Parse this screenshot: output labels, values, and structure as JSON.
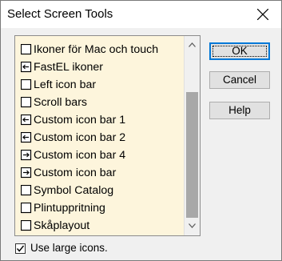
{
  "window": {
    "title": "Select Screen Tools"
  },
  "list": {
    "items": [
      {
        "label": "Ikoner för Mac och touch",
        "icon": "checkbox-empty-icon"
      },
      {
        "label": "FastEL ikoner",
        "icon": "arrow-left-box-icon"
      },
      {
        "label": "Left icon bar",
        "icon": "checkbox-empty-icon"
      },
      {
        "label": "Scroll bars",
        "icon": "checkbox-empty-icon"
      },
      {
        "label": "Custom icon bar 1",
        "icon": "arrow-left-box-icon"
      },
      {
        "label": "Custom icon bar 2",
        "icon": "arrow-left-box-icon"
      },
      {
        "label": "Custom icon bar 4",
        "icon": "arrow-right-box-icon"
      },
      {
        "label": "Custom icon bar",
        "icon": "arrow-right-box-icon"
      },
      {
        "label": "Symbol Catalog",
        "icon": "checkbox-empty-icon"
      },
      {
        "label": "Plintuppritning",
        "icon": "checkbox-empty-icon"
      },
      {
        "label": "Skåplayout",
        "icon": "checkbox-empty-icon"
      }
    ]
  },
  "buttons": {
    "ok": "OK",
    "cancel": "Cancel",
    "help": "Help"
  },
  "footer": {
    "large_icons_label": "Use large icons.",
    "large_icons_checked": true
  },
  "colors": {
    "list_background": "#fdf5dc",
    "accent": "#0078d7"
  }
}
